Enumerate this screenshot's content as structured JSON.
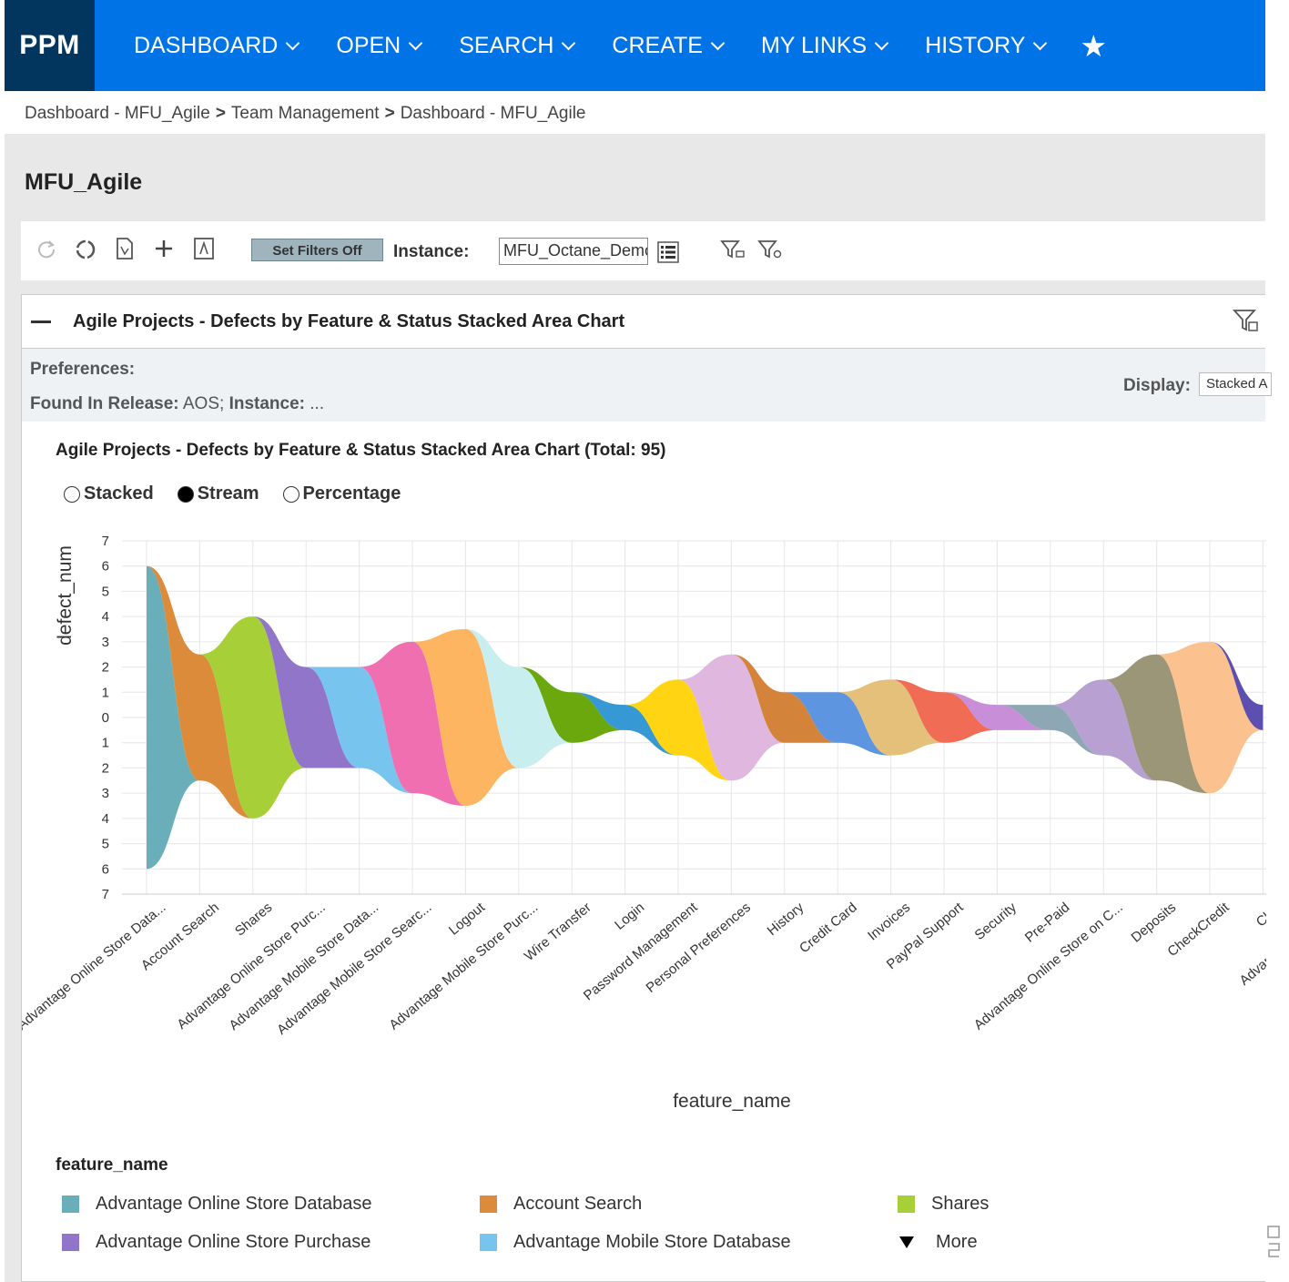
{
  "nav": {
    "brand": "PPM",
    "menu": [
      {
        "label": "DASHBOARD"
      },
      {
        "label": "OPEN"
      },
      {
        "label": "SEARCH"
      },
      {
        "label": "CREATE"
      },
      {
        "label": "MY LINKS"
      },
      {
        "label": "HISTORY"
      }
    ],
    "star": "★",
    "colors": {
      "bar": "#0073e7",
      "brand": "#02365e"
    }
  },
  "breadcrumb": {
    "items": [
      "Dashboard - MFU_Agile",
      "Team Management",
      "Dashboard - MFU_Agile"
    ],
    "separator": ">"
  },
  "page": {
    "title": "MFU_Agile"
  },
  "toolbar": {
    "set_filters_label": "Set Filters Off",
    "instance_label": "Instance:",
    "instance_value": "MFU_Octane_Demo"
  },
  "portlet": {
    "title": "Agile Projects - Defects by Feature & Status Stacked Area Chart",
    "preferences_label": "Preferences:",
    "found_in_release_label": "Found In Release:",
    "found_in_release_value": "AOS;",
    "instance_label": "Instance:",
    "instance_value": "...",
    "display_label": "Display:",
    "display_value": "Stacked A"
  },
  "chart_view": {
    "title": "Agile Projects - Defects by Feature & Status Stacked Area Chart",
    "total": "(Total: 95)",
    "modes": [
      {
        "label": "Stacked",
        "selected": false
      },
      {
        "label": "Stream",
        "selected": true
      },
      {
        "label": "Percentage",
        "selected": false
      }
    ],
    "legend_title": "feature_name",
    "legend": [
      {
        "label": "Advantage Online Store Database",
        "color": "#6aaeb9"
      },
      {
        "label": "Account Search",
        "color": "#dc8b3a"
      },
      {
        "label": "Shares",
        "color": "#a6cf38"
      },
      {
        "label": "Advantage Online Store Purchase",
        "color": "#9175c9"
      },
      {
        "label": "Advantage Mobile Store Database",
        "color": "#77c5ef"
      }
    ],
    "legend_more": "More"
  },
  "chart_data": {
    "type": "area",
    "layout": "stream",
    "xlabel": "feature_name",
    "ylabel": "defect_num",
    "yticks": [
      7,
      6,
      5,
      4,
      3,
      2,
      1,
      0,
      1,
      2,
      3,
      4,
      5,
      6,
      7
    ],
    "ylim": [
      -7,
      7
    ],
    "grid": true,
    "categories": [
      "Advantage Online Store Data...",
      "Account Search",
      "Shares",
      "Advantage Online Store Purc...",
      "Advantage Mobile Store Data...",
      "Advantage Mobile Store Searc...",
      "Logout",
      "Advantage Mobile Store Purc...",
      "Wire Transfer",
      "Login",
      "Password Management",
      "Personal Preferences",
      "History",
      "Credit Card",
      "Invoices",
      "PayPal Support",
      "Security",
      "Pre-Paid",
      "Advantage Online Store on C...",
      "Deposits",
      "CheckCredit",
      "Ch...",
      "Advantage Online..."
    ],
    "series": [
      {
        "name": "Advantage Online Store Database",
        "values": [
          12,
          0,
          0,
          0,
          0,
          0,
          0,
          0,
          0,
          0,
          0,
          0,
          0,
          0,
          0,
          0,
          0,
          0,
          0,
          0,
          0,
          0
        ]
      },
      {
        "name": "Account Search",
        "values": [
          0,
          5,
          0,
          0,
          0,
          0,
          0,
          0,
          0,
          0,
          0,
          0,
          0,
          0,
          0,
          0,
          0,
          0,
          0,
          0,
          0,
          0
        ]
      },
      {
        "name": "Shares",
        "values": [
          0,
          0,
          8,
          0,
          0,
          0,
          0,
          0,
          0,
          0,
          0,
          0,
          0,
          0,
          0,
          0,
          0,
          0,
          0,
          0,
          0,
          0
        ]
      },
      {
        "name": "Advantage Online Store Purchase",
        "values": [
          0,
          0,
          0,
          4,
          0,
          0,
          0,
          0,
          0,
          0,
          0,
          0,
          0,
          0,
          0,
          0,
          0,
          0,
          0,
          0,
          0,
          0
        ]
      },
      {
        "name": "Advantage Mobile Store Database",
        "values": [
          0,
          0,
          0,
          0,
          4,
          0,
          0,
          0,
          0,
          0,
          0,
          0,
          0,
          0,
          0,
          0,
          0,
          0,
          0,
          0,
          0,
          0
        ]
      },
      {
        "values": [
          0,
          0,
          0,
          0,
          0,
          6,
          0,
          0,
          0,
          0,
          0,
          0,
          0,
          0,
          0,
          0,
          0,
          0,
          0,
          0,
          0,
          0
        ],
        "color": "#ef6fb1"
      },
      {
        "values": [
          0,
          0,
          0,
          0,
          0,
          0,
          7,
          0,
          0,
          0,
          0,
          0,
          0,
          0,
          0,
          0,
          0,
          0,
          0,
          0,
          0,
          0
        ],
        "color": "#fdb562"
      },
      {
        "values": [
          0,
          0,
          0,
          0,
          0,
          0,
          0,
          4,
          0,
          0,
          0,
          0,
          0,
          0,
          0,
          0,
          0,
          0,
          0,
          0,
          0,
          0
        ],
        "color": "#c9eef0"
      },
      {
        "values": [
          0,
          0,
          0,
          0,
          0,
          0,
          0,
          0,
          2,
          0,
          0,
          0,
          0,
          0,
          0,
          0,
          0,
          0,
          0,
          0,
          0,
          0
        ],
        "color": "#6aa80e"
      },
      {
        "values": [
          0,
          0,
          0,
          0,
          0,
          0,
          0,
          0,
          0,
          1,
          0,
          0,
          0,
          0,
          0,
          0,
          0,
          0,
          0,
          0,
          0,
          0
        ],
        "color": "#3799d4"
      },
      {
        "values": [
          0,
          0,
          0,
          0,
          0,
          0,
          0,
          0,
          0,
          0,
          3,
          0,
          0,
          0,
          0,
          0,
          0,
          0,
          0,
          0,
          0,
          0
        ],
        "color": "#ffd412"
      },
      {
        "values": [
          0,
          0,
          0,
          0,
          0,
          0,
          0,
          0,
          0,
          0,
          0,
          5,
          0,
          0,
          0,
          0,
          0,
          0,
          0,
          0,
          0,
          0
        ],
        "color": "#e0b7df"
      },
      {
        "values": [
          0,
          0,
          0,
          0,
          0,
          0,
          0,
          0,
          0,
          0,
          0,
          0,
          2,
          0,
          0,
          0,
          0,
          0,
          0,
          0,
          0,
          0
        ],
        "color": "#d4843a"
      },
      {
        "values": [
          0,
          0,
          0,
          0,
          0,
          0,
          0,
          0,
          0,
          0,
          0,
          0,
          0,
          2,
          0,
          0,
          0,
          0,
          0,
          0,
          0,
          0
        ],
        "color": "#5d95e0"
      },
      {
        "values": [
          0,
          0,
          0,
          0,
          0,
          0,
          0,
          0,
          0,
          0,
          0,
          0,
          0,
          0,
          3,
          0,
          0,
          0,
          0,
          0,
          0,
          0
        ],
        "color": "#e5c07a"
      },
      {
        "values": [
          0,
          0,
          0,
          0,
          0,
          0,
          0,
          0,
          0,
          0,
          0,
          0,
          0,
          0,
          0,
          2,
          0,
          0,
          0,
          0,
          0,
          0
        ],
        "color": "#f06c54"
      },
      {
        "values": [
          0,
          0,
          0,
          0,
          0,
          0,
          0,
          0,
          0,
          0,
          0,
          0,
          0,
          0,
          0,
          0,
          1,
          0,
          0,
          0,
          0,
          0
        ],
        "color": "#c98ed8"
      },
      {
        "values": [
          0,
          0,
          0,
          0,
          0,
          0,
          0,
          0,
          0,
          0,
          0,
          0,
          0,
          0,
          0,
          0,
          0,
          1,
          0,
          0,
          0,
          0
        ],
        "color": "#8da7b4"
      },
      {
        "values": [
          0,
          0,
          0,
          0,
          0,
          0,
          0,
          0,
          0,
          0,
          0,
          0,
          0,
          0,
          0,
          0,
          0,
          0,
          3,
          0,
          0,
          0
        ],
        "color": "#b8a1d2"
      },
      {
        "values": [
          0,
          0,
          0,
          0,
          0,
          0,
          0,
          0,
          0,
          0,
          0,
          0,
          0,
          0,
          0,
          0,
          0,
          0,
          0,
          5,
          0,
          0
        ],
        "color": "#9b9678"
      },
      {
        "values": [
          0,
          0,
          0,
          0,
          0,
          0,
          0,
          0,
          0,
          0,
          0,
          0,
          0,
          0,
          0,
          0,
          0,
          0,
          0,
          0,
          6,
          0
        ],
        "color": "#fbc18e"
      },
      {
        "values": [
          0,
          0,
          0,
          0,
          0,
          0,
          0,
          0,
          0,
          0,
          0,
          0,
          0,
          0,
          0,
          0,
          0,
          0,
          0,
          0,
          0,
          1
        ],
        "color": "#5d4fb0"
      }
    ]
  }
}
